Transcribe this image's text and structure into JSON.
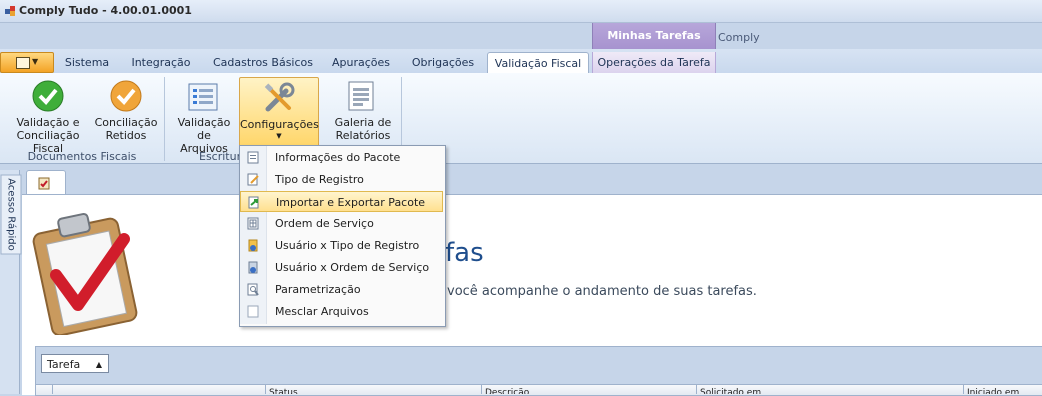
{
  "window": {
    "title": "Comply Tudo - 4.00.01.0001"
  },
  "contextual": {
    "group_title": "Minhas Tarefas",
    "app_label": "Comply"
  },
  "tabs": [
    {
      "label": "Sistema"
    },
    {
      "label": "Integração"
    },
    {
      "label": "Cadastros Básicos"
    },
    {
      "label": "Apurações"
    },
    {
      "label": "Obrigações"
    },
    {
      "label": "Validação Fiscal",
      "active": true
    },
    {
      "label": "Operações da Tarefa",
      "contextual": true
    }
  ],
  "ribbon": {
    "buttons": [
      {
        "line1": "Validação e",
        "line2": "Conciliação Fiscal",
        "icon": "green-check-icon"
      },
      {
        "line1": "Conciliação",
        "line2": "Retidos",
        "icon": "orange-check-icon"
      },
      {
        "line1": "Validação",
        "line2": "de Arquivos",
        "icon": "validation-list-icon"
      },
      {
        "line1": "Configurações",
        "line2": "",
        "icon": "tools-icon"
      },
      {
        "line1": "Galeria de",
        "line2": "Relatórios",
        "icon": "report-gallery-icon"
      }
    ],
    "groups": [
      "Documentos Fiscais",
      "Escritura"
    ]
  },
  "sidebar": {
    "quick_access": "Acesso Rápido"
  },
  "main": {
    "title": "fas",
    "subtitle": "você acompanhe o andamento de suas tarefas."
  },
  "grid": {
    "group_by": "Tarefa",
    "columns": [
      "Status",
      "Descrição",
      "Solicitado em",
      "Iniciado em"
    ]
  },
  "menu": {
    "items": [
      {
        "label": "Informações do Pacote",
        "icon": "package-info-icon"
      },
      {
        "label": "Tipo de Registro",
        "icon": "edit-record-icon"
      },
      {
        "label": "Importar e Exportar Pacote",
        "icon": "import-export-icon",
        "highlighted": true
      },
      {
        "label": "Ordem de Serviço",
        "icon": "service-order-icon"
      },
      {
        "label": "Usuário x Tipo de Registro",
        "icon": "user-record-icon"
      },
      {
        "label": "Usuário x Ordem de Serviço",
        "icon": "user-order-icon"
      },
      {
        "label": "Parametrização",
        "icon": "parameters-icon"
      },
      {
        "label": "Mesclar Arquivos",
        "icon": "merge-files-icon"
      }
    ]
  },
  "colors": {
    "accent": "#1f4e8d",
    "ribbon_highlight": "#ffd66a",
    "contextual": "#a793cf"
  }
}
